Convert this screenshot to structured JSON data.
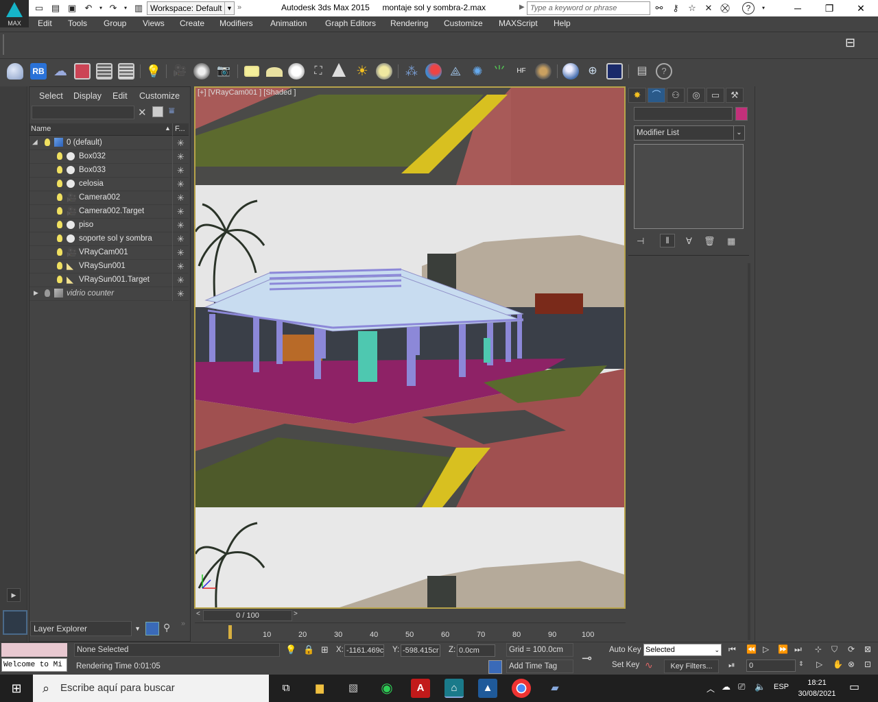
{
  "titlebar": {
    "logo_label": "MAX",
    "workspace": "Workspace: Default",
    "app_title": "Autodesk 3ds Max  2015",
    "file_name": "montaje sol y sombra-2.max",
    "search_placeholder": "Type a keyword or phrase"
  },
  "menu": [
    "Edit",
    "Tools",
    "Group",
    "Views",
    "Create",
    "Modifiers",
    "Animation",
    "Graph Editors",
    "Rendering",
    "Customize",
    "MAXScript",
    "Help"
  ],
  "toolbar": {
    "rb_label": "RB"
  },
  "scene_explorer": {
    "menu": [
      "Select",
      "Display",
      "Edit",
      "Customize"
    ],
    "col_name": "Name",
    "col_freeze": "F...",
    "layer_default": "0 (default)",
    "items": [
      "Box032",
      "Box033",
      "celosia",
      "Camera002",
      "Camera002.Target",
      "piso",
      "soporte sol y sombra",
      "VRayCam001",
      "VRaySun001",
      "VRaySun001.Target"
    ],
    "layer_other": "vidrio counter",
    "layer_explorer": "Layer Explorer"
  },
  "viewport": {
    "label": "[+] [VRayCam001 ] [Shaded ]"
  },
  "command_panel": {
    "modifier_list": "Modifier List",
    "object_color": "#c2307a"
  },
  "timeline": {
    "slider": "0 / 100",
    "ticks": [
      "10",
      "20",
      "30",
      "40",
      "50",
      "60",
      "70",
      "80",
      "90",
      "100"
    ]
  },
  "status": {
    "maxscript_output": "Welcome to Mi",
    "selection": "None Selected",
    "render_time": "Rendering Time  0:01:05",
    "x_label": "X:",
    "x_value": "-1161.469c",
    "y_label": "Y:",
    "y_value": "-598.415cr",
    "z_label": "Z:",
    "z_value": "0.0cm",
    "grid": "Grid = 100.0cm",
    "add_time_tag": "Add Time Tag",
    "auto_key": "Auto Key",
    "set_key": "Set Key",
    "selected": "Selected",
    "key_filters": "Key Filters...",
    "frame": "0"
  },
  "taskbar": {
    "search_placeholder": "Escribe aquí para buscar",
    "lang": "ESP",
    "time": "18:21",
    "date": "30/08/2021"
  }
}
